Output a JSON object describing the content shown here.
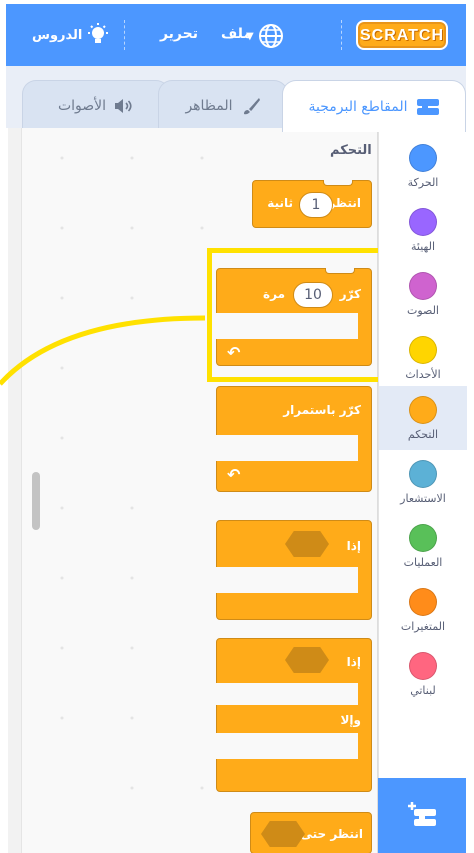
{
  "menubar": {
    "logo": "SCRATCH",
    "file": "ملف",
    "edit": "تحرير",
    "tutorials": "الدروس"
  },
  "tabs": {
    "code": "المقاطع البرمجية",
    "costumes": "المظاهر",
    "sounds": "الأصوات"
  },
  "categories": [
    {
      "label": "الحركة",
      "color": "#4c97ff"
    },
    {
      "label": "الهيئة",
      "color": "#9966ff"
    },
    {
      "label": "الصوت",
      "color": "#cf63cf"
    },
    {
      "label": "الأحداث",
      "color": "#ffd500"
    },
    {
      "label": "التحكم",
      "color": "#ffab19"
    },
    {
      "label": "الاستشعار",
      "color": "#5cb1d6"
    },
    {
      "label": "العمليات",
      "color": "#59c059"
    },
    {
      "label": "المتغيرات",
      "color": "#ff8c1a"
    },
    {
      "label": "لبناتي",
      "color": "#ff6680"
    }
  ],
  "palette": {
    "section_title": "التحكم",
    "wait": {
      "label": "انتظر",
      "value": "1",
      "unit": "ثانية"
    },
    "repeat": {
      "label": "كرّر",
      "value": "10",
      "unit": "مرة"
    },
    "forever": {
      "label": "كرّر باستمرار"
    },
    "if_then": {
      "label": "إذا"
    },
    "if_else": {
      "label_if": "إذا",
      "label_else": "وإلا"
    },
    "wait_until": {
      "label": "انتظر حتى"
    }
  },
  "colors": {
    "control": "#ffab19",
    "highlight": "#ffe100",
    "menubar": "#4c97ff"
  }
}
